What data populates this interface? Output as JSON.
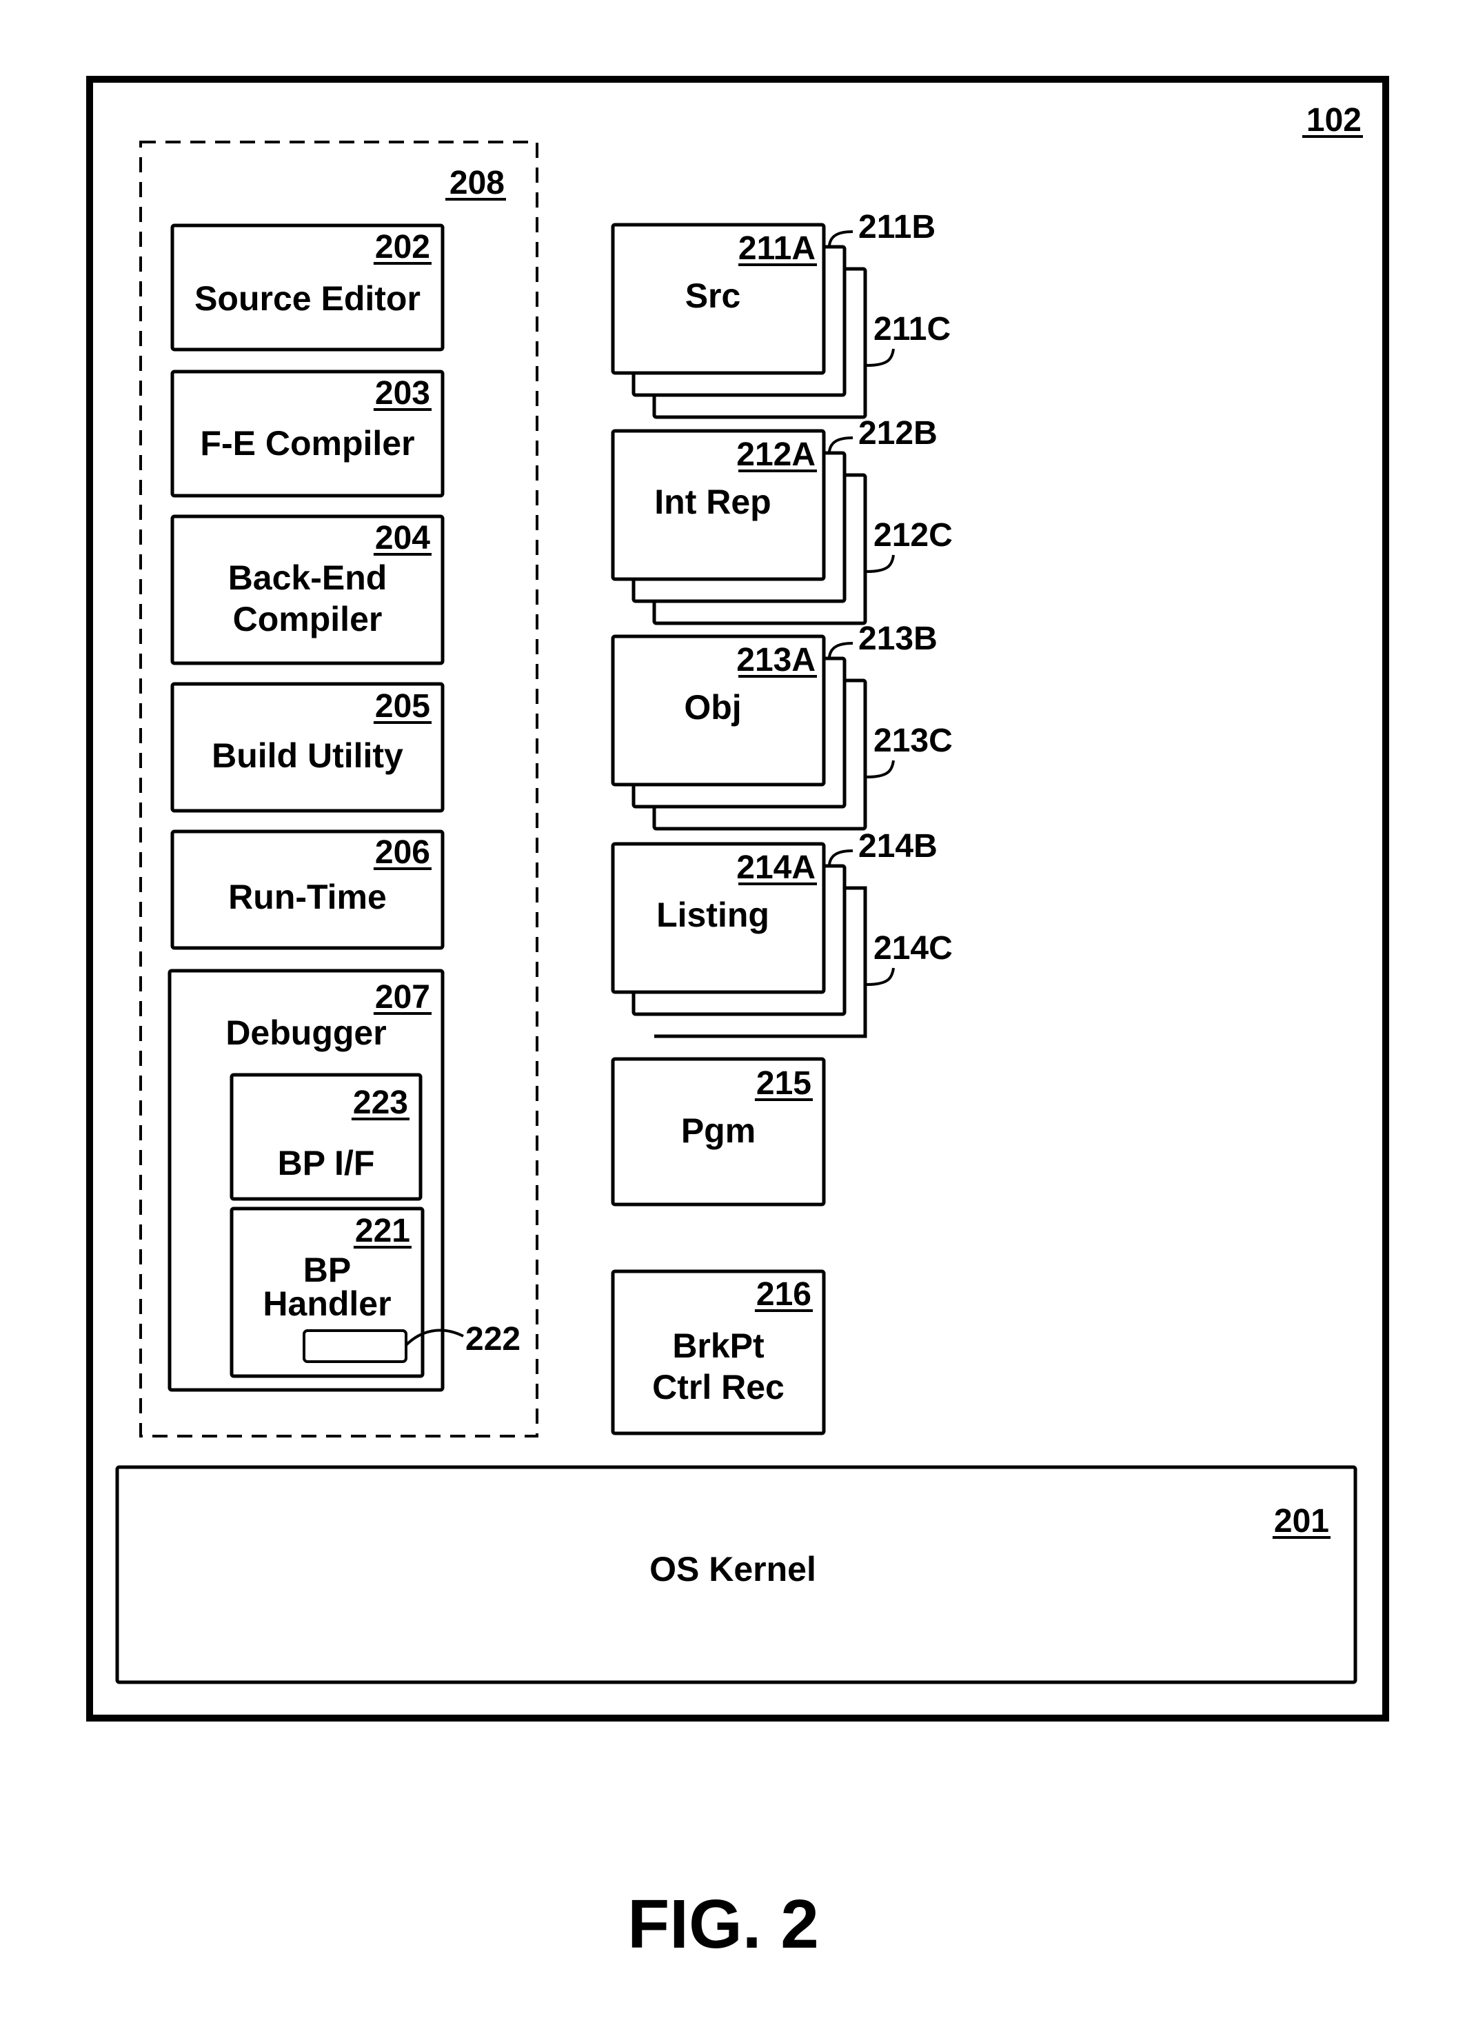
{
  "figure": {
    "caption": "FIG. 2",
    "system_ref": "102",
    "group_ref": "208"
  },
  "components": [
    {
      "id": "source-editor",
      "ref": "202",
      "lines": [
        "Source Editor"
      ]
    },
    {
      "id": "fe-compiler",
      "ref": "203",
      "lines": [
        "F-E Compiler"
      ]
    },
    {
      "id": "back-end-compiler",
      "ref": "204",
      "lines": [
        "Back-End",
        "Compiler"
      ]
    },
    {
      "id": "build-utility",
      "ref": "205",
      "lines": [
        "Build Utility"
      ]
    },
    {
      "id": "run-time",
      "ref": "206",
      "lines": [
        "Run-Time"
      ]
    },
    {
      "id": "debugger",
      "ref": "207",
      "lines": [
        "Debugger"
      ]
    },
    {
      "id": "bp-interface",
      "ref": "223",
      "lines": [
        "BP I/F"
      ]
    },
    {
      "id": "bp-handler",
      "ref": "221",
      "lines": [
        "BP",
        "Handler"
      ]
    },
    {
      "id": "pgm",
      "ref": "215",
      "lines": [
        "Pgm"
      ]
    },
    {
      "id": "brkpt-ctrl-rec",
      "ref": "216",
      "lines": [
        "BrkPt",
        "Ctrl Rec"
      ]
    },
    {
      "id": "os-kernel",
      "ref": "201",
      "lines": [
        "OS Kernel"
      ]
    }
  ],
  "handler_field": {
    "ref": "222"
  },
  "stacks": [
    {
      "id": "src",
      "title": "Src",
      "refs": [
        "211A",
        "211B",
        "211C"
      ]
    },
    {
      "id": "int-rep",
      "title": "Int Rep",
      "refs": [
        "212A",
        "212B",
        "212C"
      ]
    },
    {
      "id": "obj",
      "title": "Obj",
      "refs": [
        "213A",
        "213B",
        "213C"
      ]
    },
    {
      "id": "listing",
      "title": "Listing",
      "refs": [
        "214A",
        "214B",
        "214C"
      ]
    }
  ]
}
